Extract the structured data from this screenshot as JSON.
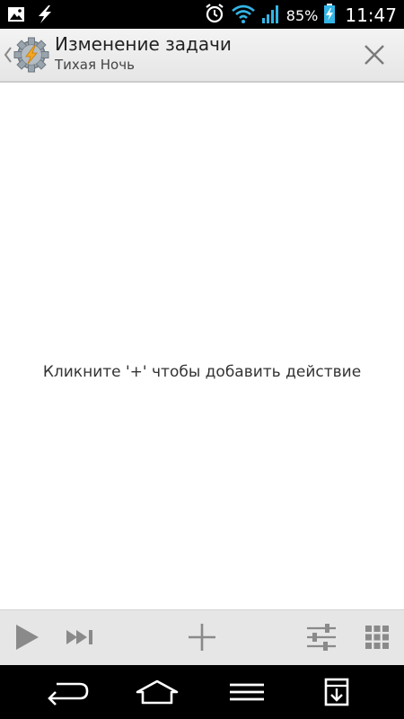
{
  "status_bar": {
    "battery_percent": "85%",
    "time": "11:47",
    "icons": [
      "picture-icon",
      "flash-icon",
      "alarm-icon",
      "wifi-icon",
      "signal-icon",
      "battery-charging-icon"
    ]
  },
  "action_bar": {
    "title": "Изменение задачи",
    "subtitle": "Тихая Ночь",
    "app_icon": "tasker-gear-icon",
    "close_icon": "close-icon"
  },
  "main": {
    "empty_hint": "Кликните '+' чтобы добавить действие"
  },
  "toolbar": {
    "icons": [
      "play-icon",
      "skip-forward-icon",
      "plus-icon",
      "sliders-icon",
      "grid-icon"
    ]
  },
  "nav_bar": {
    "icons": [
      "back-icon",
      "home-icon",
      "menu-icon",
      "notification-icon"
    ]
  },
  "colors": {
    "status_bar_bg": "#000000",
    "action_bar_bg": "#ececec",
    "wifi_accent": "#33b5e5",
    "battery_accent": "#33b5e5",
    "toolbar_bg": "#e6e6e6",
    "toolbar_icon": "#8a8a8a"
  }
}
